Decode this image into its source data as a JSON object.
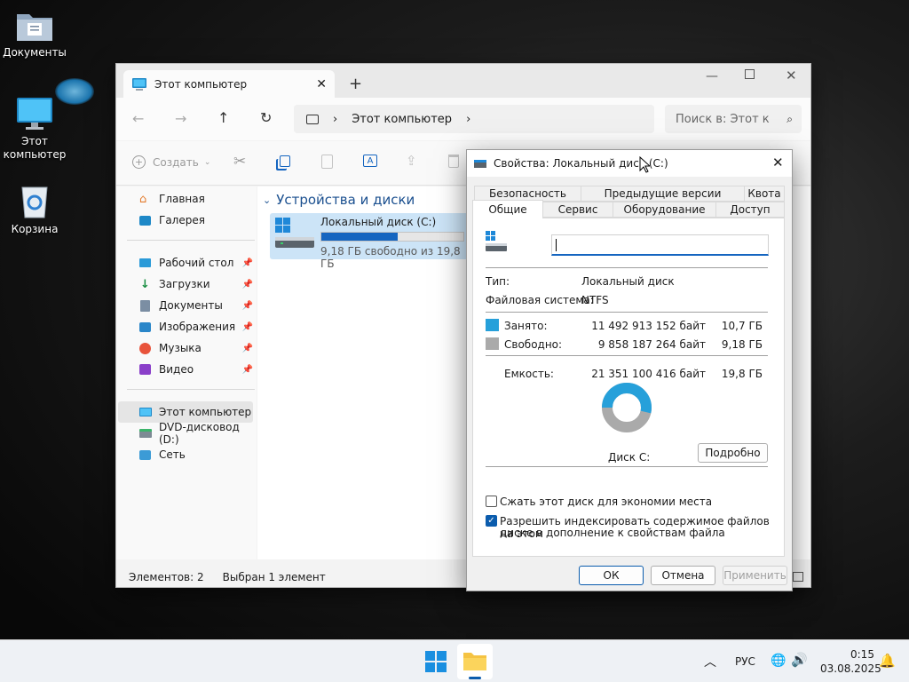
{
  "desktop": {
    "icons": [
      {
        "label": "Документы",
        "icon": "documents-folder-icon"
      },
      {
        "label": "Этот\nкомпьютер",
        "icon": "computer-icon"
      },
      {
        "label": "Корзина",
        "icon": "recycle-bin-icon"
      }
    ]
  },
  "explorer": {
    "tab_title": "Этот компьютер",
    "breadcrumb": "Этот компьютер",
    "search_placeholder": "Поиск в: Этот к",
    "create_label": "Создать",
    "nav": {
      "home": "Главная",
      "gallery": "Галерея",
      "desktop": "Рабочий стол",
      "downloads": "Загрузки",
      "documents": "Документы",
      "pictures": "Изображения",
      "music": "Музыка",
      "videos": "Видео",
      "this_pc": "Этот компьютер",
      "dvd": "DVD-дисковод (D:)",
      "network": "Сеть"
    },
    "section_title": "Устройства и диски",
    "drive": {
      "name": "Локальный диск (C:)",
      "free_text": "9,18 ГБ свободно из 19,8 ГБ",
      "used_fraction": 0.536
    },
    "status": {
      "items": "Элементов: 2",
      "selected": "Выбран 1 элемент"
    }
  },
  "dialog": {
    "title": "Свойства: Локальный диск (C:)",
    "tabs_row1": [
      "Безопасность",
      "Предыдущие версии",
      "Квота"
    ],
    "tabs_row2": [
      "Общие",
      "Сервис",
      "Оборудование",
      "Доступ"
    ],
    "active_tab": "Общие",
    "label_value": "",
    "type_label": "Тип:",
    "type_value": "Локальный диск",
    "fs_label": "Файловая система:",
    "fs_value": "NTFS",
    "used_label": "Занято:",
    "used_bytes": "11 492 913 152 байт",
    "used_gb": "10,7 ГБ",
    "free_label": "Свободно:",
    "free_bytes": "9 858 187 264 байт",
    "free_gb": "9,18 ГБ",
    "capacity_label": "Емкость:",
    "capacity_bytes": "21 351 100 416 байт",
    "capacity_gb": "19,8 ГБ",
    "disk_label": "Диск C:",
    "details_button": "Подробно",
    "compress_label": "Сжать этот диск для экономии места",
    "compress_checked": false,
    "index_label_1": "Разрешить индексировать содержимое файлов на этом",
    "index_label_2": "диске в дополнение к свойствам файла",
    "index_checked": true,
    "ok": "ОК",
    "cancel": "Отмена",
    "apply": "Применить",
    "colors": {
      "used": "#26a0da",
      "free": "#aaaaaa"
    }
  },
  "taskbar": {
    "language": "РУС",
    "time": "0:15",
    "date": "03.08.2025"
  }
}
